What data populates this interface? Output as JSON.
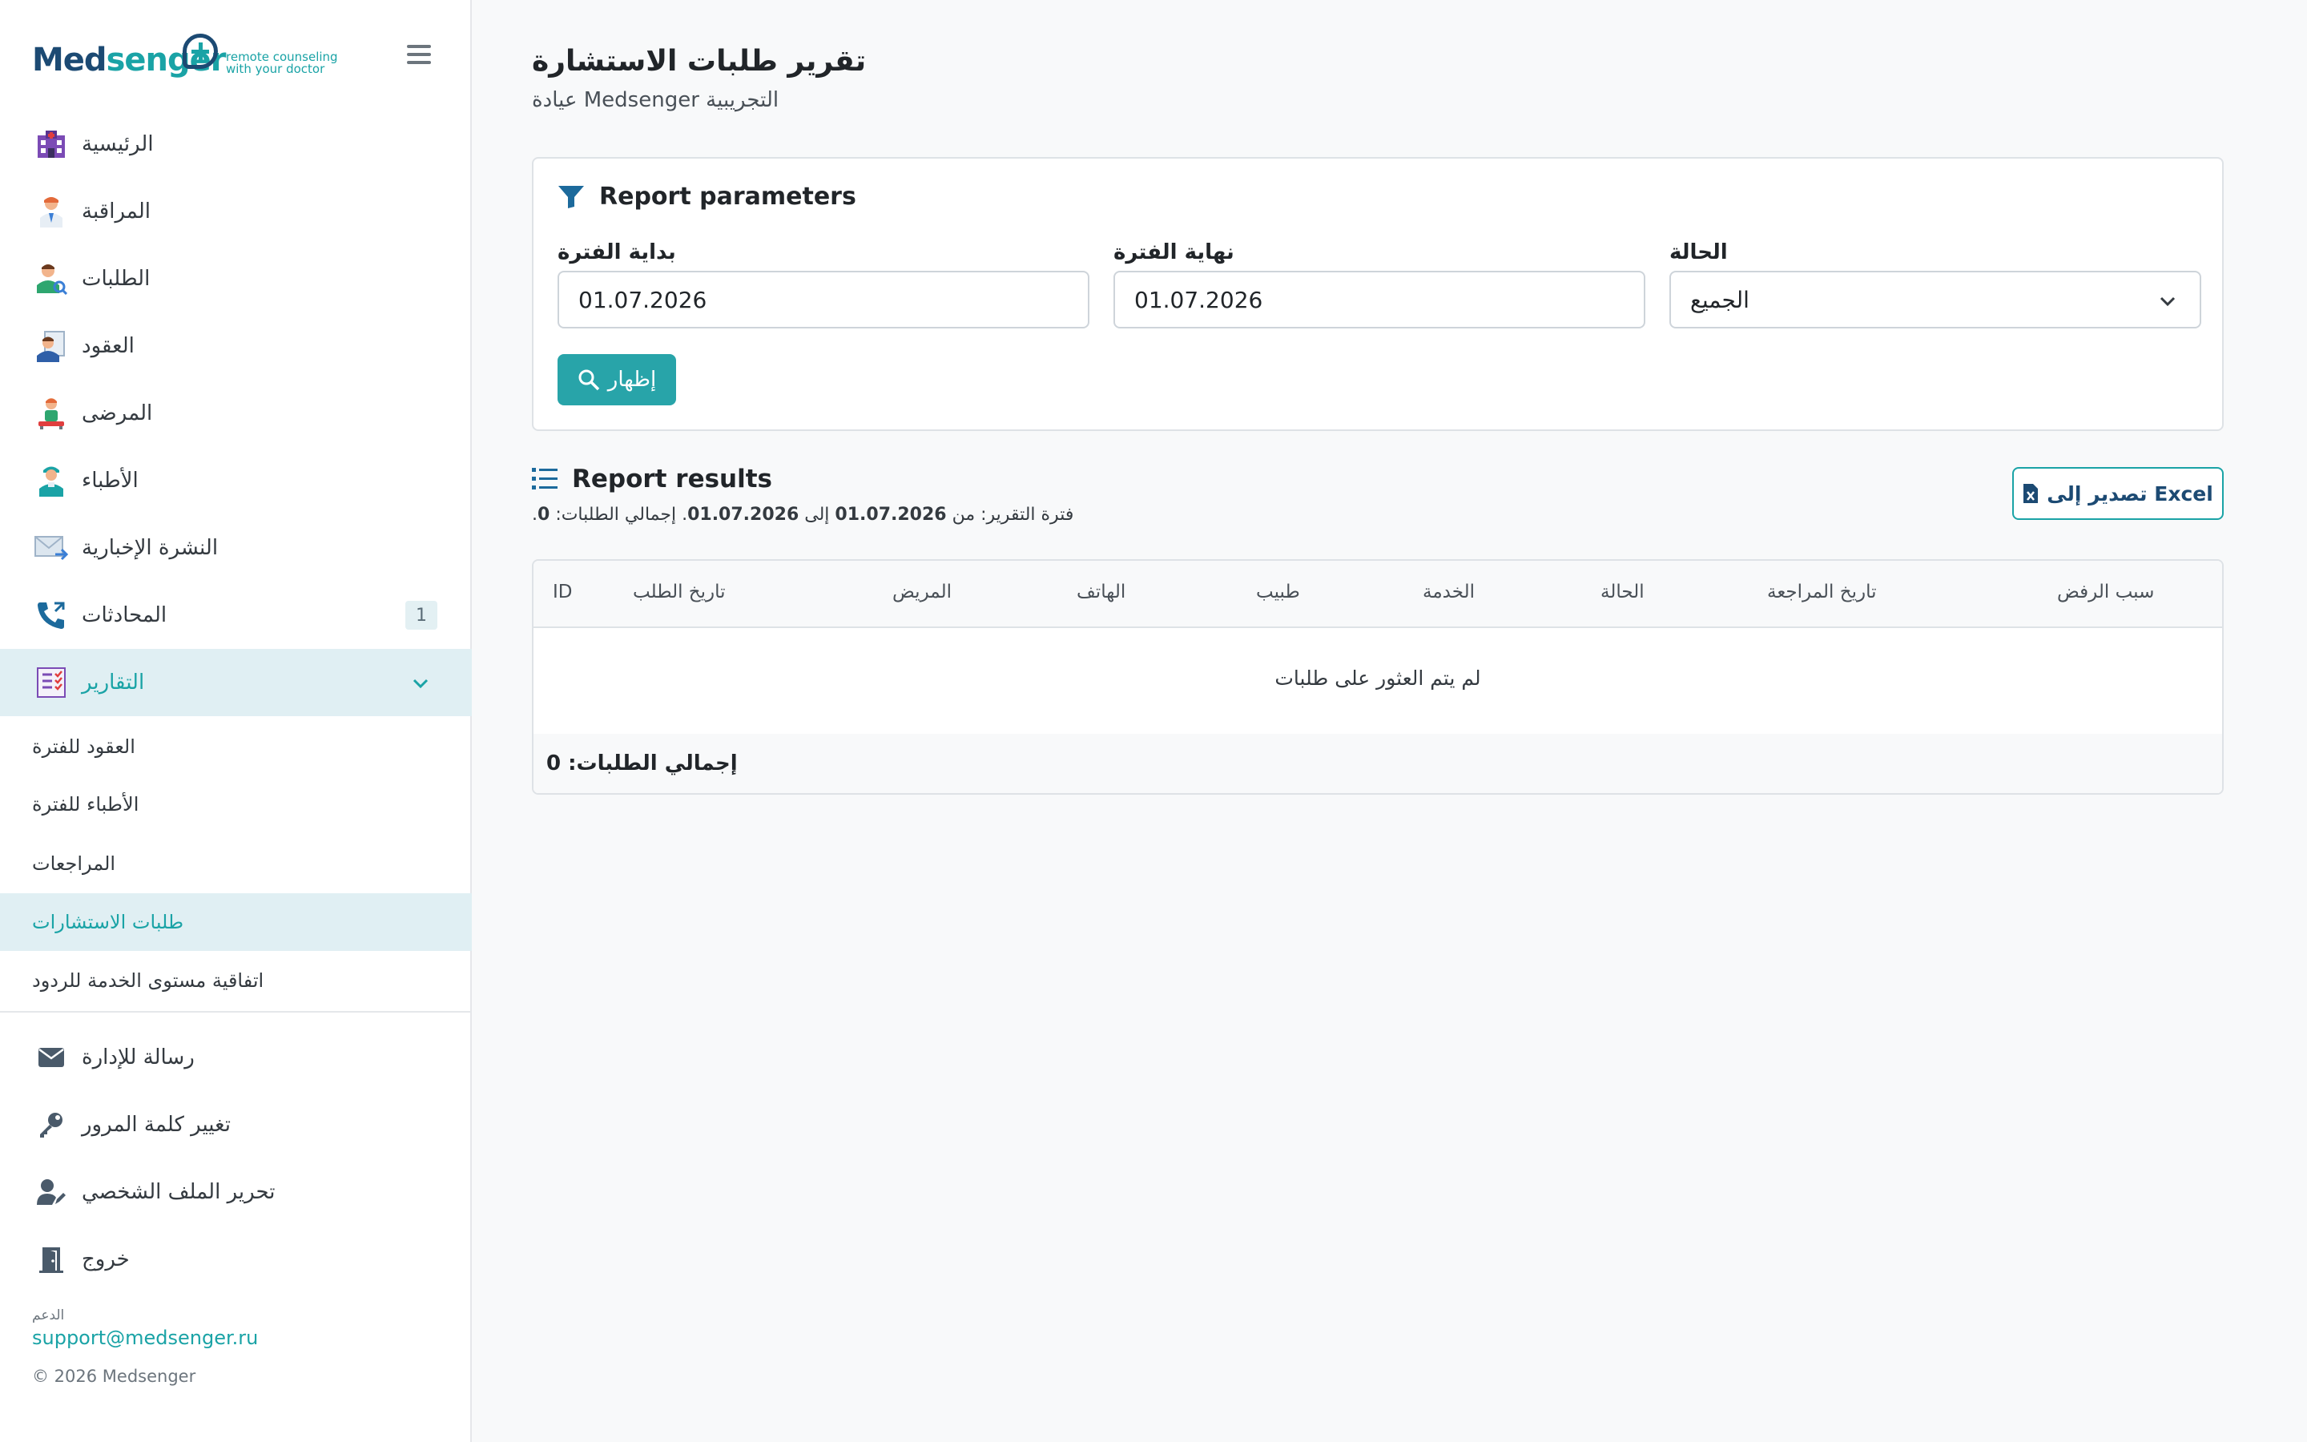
{
  "brand": {
    "name_part1": "Med",
    "name_part2": "senger",
    "tagline_line1": "remote counseling",
    "tagline_line2": "with your doctor"
  },
  "sidebar": {
    "items": [
      {
        "label": "الرئيسية",
        "icon": "hospital-icon"
      },
      {
        "label": "المراقبة",
        "icon": "doctor-icon"
      },
      {
        "label": "الطلبات",
        "icon": "user-search-icon"
      },
      {
        "label": "العقود",
        "icon": "contract-icon"
      },
      {
        "label": "المرضى",
        "icon": "patient-icon"
      },
      {
        "label": "الأطباء",
        "icon": "physician-icon"
      },
      {
        "label": "النشرة الإخبارية",
        "icon": "mail-forward-icon"
      },
      {
        "label": "المحادثات",
        "icon": "phone-icon",
        "badge": "1"
      },
      {
        "label": "التقارير",
        "icon": "report-icon"
      }
    ],
    "report_subitems": [
      "العقود للفترة",
      "الأطباء للفترة",
      "المراجعات",
      "طلبات الاستشارات",
      "اتفاقية مستوى الخدمة للردود"
    ],
    "bottom_items": [
      {
        "label": "رسالة للإدارة",
        "icon": "envelope-icon"
      },
      {
        "label": "تغيير كلمة المرور",
        "icon": "key-icon"
      },
      {
        "label": "تحرير الملف الشخصي",
        "icon": "user-edit-icon"
      },
      {
        "label": "خروج",
        "icon": "door-exit-icon"
      }
    ],
    "support_caption": "الدعم",
    "support_email": "support@medsenger.ru",
    "copyright": "© 2026 Medsenger"
  },
  "page": {
    "title": "تقرير طلبات الاستشارة",
    "subtitle": "عيادة Medsenger التجريبية"
  },
  "params": {
    "heading": "Report parameters",
    "start_label": "بداية الفترة",
    "start_value": "01.07.2026",
    "end_label": "نهاية الفترة",
    "end_value": "01.07.2026",
    "status_label": "الحالة",
    "status_value": "الجميع",
    "show_button": "إظهار"
  },
  "results": {
    "heading": "Report results",
    "period_prefix": ".فترة التقرير: من",
    "period_from": "01.07.2026",
    "period_to_word": "إلى",
    "period_to": "01.07.2026",
    "total_inline_label": ". إجمالي الطلبات:",
    "total_inline_value": "0",
    "export_button": "تصدير إلى Excel",
    "columns": [
      "ID",
      "تاريخ الطلب",
      "المريض",
      "الهاتف",
      "طبيب",
      "الخدمة",
      "الحالة",
      "تاريخ المراجعة",
      "سبب الرفض"
    ],
    "empty_text": "لم يتم العثور على طلبات",
    "footer_total": "إجمالي الطلبات: 0"
  },
  "colors": {
    "accent": "#1aa3a6",
    "brand_dark": "#1c4a73",
    "active_bg": "#e0eff3"
  }
}
